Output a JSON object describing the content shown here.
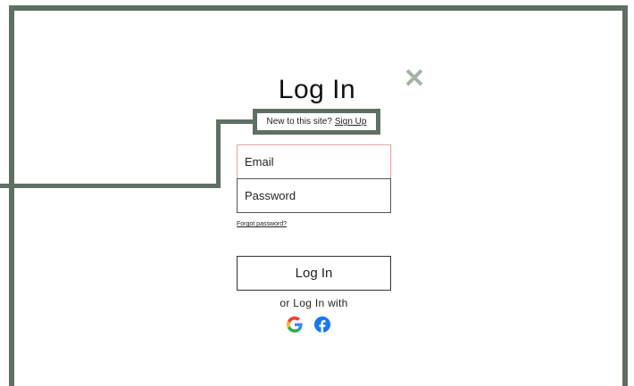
{
  "dialog": {
    "title": "Log In",
    "signup_prompt": "New to this site?",
    "signup_link": "Sign Up",
    "email_placeholder": "Email",
    "password_placeholder": "Password",
    "forgot_password": "Forgot password?",
    "login_button": "Log In",
    "alt_login_text": "or Log In with",
    "social_providers": [
      "google-icon",
      "facebook-icon"
    ]
  },
  "colors": {
    "annotation_frame": "#5f6f63",
    "close_icon": "#a5b2a5",
    "email_border": "#e3a5a5",
    "google_blue": "#4285F4",
    "google_red": "#EA4335",
    "google_yellow": "#FBBC05",
    "google_green": "#34A853",
    "facebook_blue": "#1877F2"
  }
}
